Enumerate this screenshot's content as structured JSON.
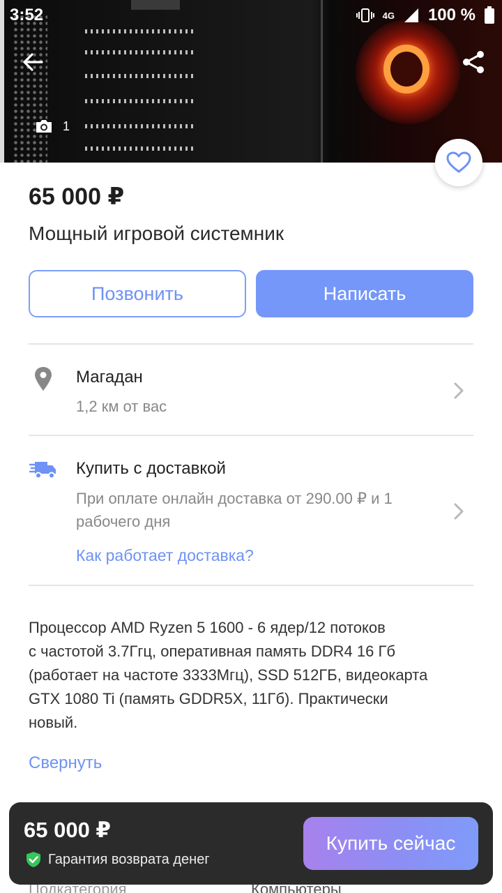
{
  "status_bar": {
    "time": "3:52",
    "network": "4G",
    "battery": "100 %"
  },
  "gallery": {
    "photo_count": "1"
  },
  "listing": {
    "price": "65 000 ₽",
    "title": "Мощный игровой системник"
  },
  "actions": {
    "call_label": "Позвонить",
    "write_label": "Написать"
  },
  "location": {
    "city": "Магадан",
    "distance": "1,2 км от вас"
  },
  "delivery": {
    "title": "Купить с доставкой",
    "line1": "При оплате онлайн доставка от 290.00 ₽ и 1",
    "line2": "рабочего дня",
    "link": "Как работает доставка?"
  },
  "description": {
    "lines": [
      "Процессор AMD Ryzen 5 1600 - 6 ядер/12 потоков",
      "с частотой 3.7Ггц, оперативная память DDR4 16 Гб",
      "(работает на частоте 3333Мгц), SSD 512ГБ, видеокарта",
      "GTX 1080 Ti (память GDDR5X, 11Гб). Практически",
      "новый."
    ],
    "collapse_label": "Свернуть"
  },
  "details_peek": {
    "label": "Подкатегория",
    "value": "Компьютеры"
  },
  "buy_bar": {
    "price": "65 000 ₽",
    "guarantee": "Гарантия возврата денег",
    "buy_label": "Купить сейчас"
  },
  "colors": {
    "accent": "#7597f9",
    "link": "#6e92f5",
    "guarantee": "#35c759",
    "bar_bg": "#2b2b2b"
  },
  "icons": [
    "back-arrow-icon",
    "share-icon",
    "camera-icon",
    "heart-icon",
    "location-pin-icon",
    "delivery-truck-icon",
    "chevron-right-icon",
    "shield-check-icon"
  ]
}
